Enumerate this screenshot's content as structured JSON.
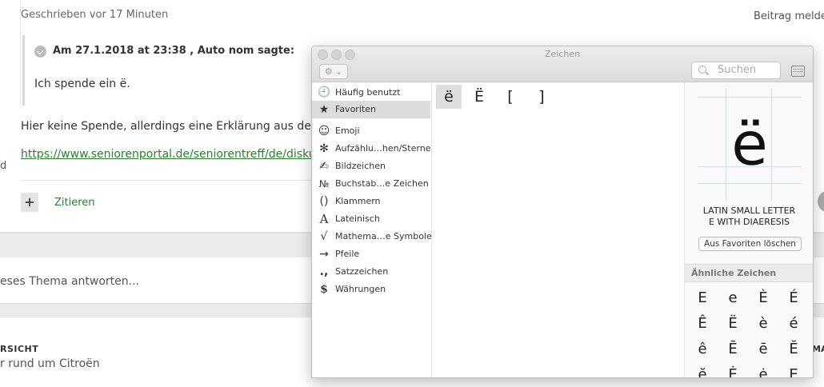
{
  "post": {
    "meta": "Geschrieben vor 17 Minuten",
    "report": "Beitrag melden",
    "quote_header": "Am 27.1.2018 at 23:38 , Auto nom sagte:",
    "quote_text": "Ich spende ein ë.",
    "body_text": "Hier keine Spende, allerdings eine Erklärung aus der Kno",
    "link_text": "https://www.seniorenportal.de/seniorentreff/de/diskuss",
    "stray": "d",
    "quote_action": "Zitieren",
    "plus": "+"
  },
  "reply": {
    "placeholder": "eses Thema antworten..."
  },
  "footer": {
    "heading": "RSICHT",
    "text": "r rund um Citroën",
    "heading_right": "MA"
  },
  "character_viewer": {
    "title": "Zeichen",
    "search_placeholder": "Suchen",
    "gear_label": "⚙ ⌄",
    "categories": [
      {
        "icon": "🕘",
        "label": "Häufig benutzt"
      },
      {
        "icon": "★",
        "label": "Favoriten",
        "selected": true
      },
      {
        "icon": "☺",
        "label": "Emoji"
      },
      {
        "icon": "✻",
        "label": "Aufzählu…hen/Sterne"
      },
      {
        "icon": "✍",
        "label": "Bildzeichen"
      },
      {
        "icon": "№",
        "label": "Buchstab…e Zeichen"
      },
      {
        "icon": "()",
        "label": "Klammern"
      },
      {
        "icon": "A",
        "label": "Lateinisch"
      },
      {
        "icon": "√",
        "label": "Mathema…e Symbole"
      },
      {
        "icon": "→",
        "label": "Pfeile"
      },
      {
        "icon": ".,",
        "label": "Satzzeichen"
      },
      {
        "icon": "$",
        "label": "Währungen"
      }
    ],
    "favorites": [
      "ë",
      "Ë",
      "[",
      "]"
    ],
    "selected_char": "ë",
    "char_name_line1": "LATIN SMALL LETTER",
    "char_name_line2": "E WITH DIAERESIS",
    "remove_favorite_label": "Aus Favoriten löschen",
    "similar_heading": "Ähnliche Zeichen",
    "similar_chars": [
      "E",
      "e",
      "È",
      "É",
      "Ê",
      "Ë",
      "è",
      "é",
      "ê",
      "Ē",
      "ē",
      "Ĕ",
      "ĕ",
      "Ė",
      "ė",
      "Ę"
    ]
  }
}
